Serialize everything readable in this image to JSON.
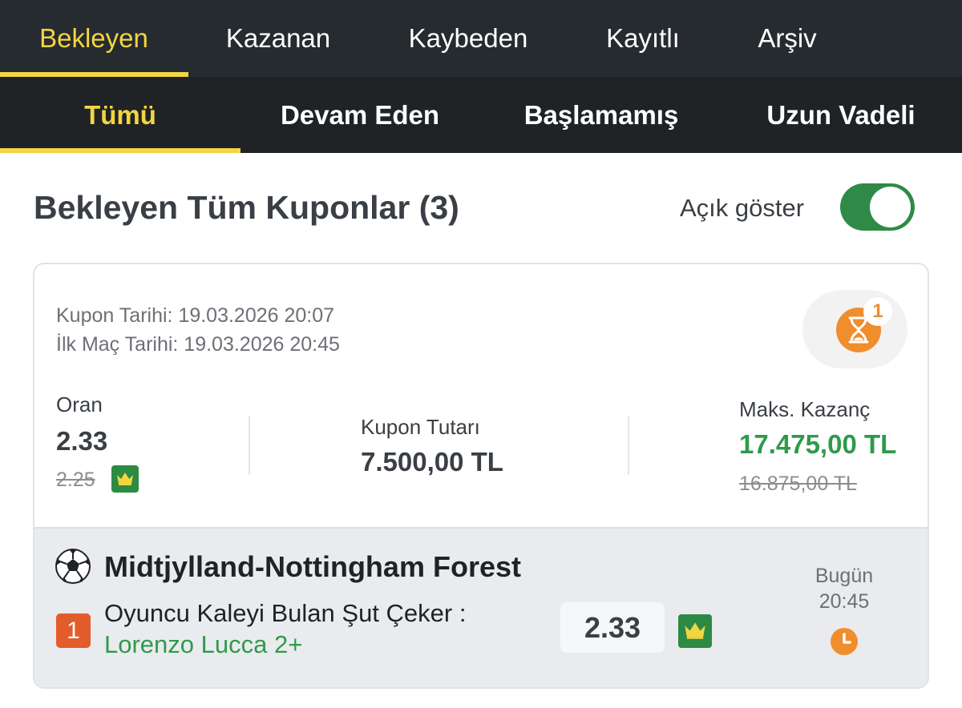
{
  "top_tabs": [
    "Bekleyen",
    "Kazanan",
    "Kaybeden",
    "Kayıtlı",
    "Arşiv"
  ],
  "sub_tabs": [
    "Tümü",
    "Devam Eden",
    "Başlamamış",
    "Uzun Vadeli"
  ],
  "heading": {
    "title": "Bekleyen Tüm Kuponlar (3)",
    "toggle_label": "Açık göster",
    "toggle_on": true
  },
  "coupon": {
    "date_line": "Kupon Tarihi: 19.03.2026 20:07",
    "first_match_line": "İlk Maç Tarihi: 19.03.2026 20:45",
    "status_count": "1",
    "odds_label": "Oran",
    "odds_value": "2.33",
    "odds_old": "2.25",
    "stake_label": "Kupon Tutarı",
    "stake_value": "7.500,00 TL",
    "max_win_label": "Maks. Kazanç",
    "max_win_value": "17.475,00 TL",
    "max_win_old": "16.875,00 TL"
  },
  "match": {
    "title": "Midtjylland-Nottingham Forest",
    "selection_number": "1",
    "market": "Oyuncu Kaleyi Bulan Şut Çeker :",
    "selection": "Lorenzo Lucca 2+",
    "odd": "2.33",
    "day": "Bugün",
    "time": "20:45"
  },
  "colors": {
    "accent_yellow": "#f3d542",
    "win_green": "#2f9a4c",
    "status_orange": "#f08d2c",
    "selection_red": "#e35c2b",
    "nav_dark": "#262b30"
  },
  "icons": [
    "hourglass-icon",
    "crown-icon",
    "football-icon",
    "clock-icon"
  ]
}
